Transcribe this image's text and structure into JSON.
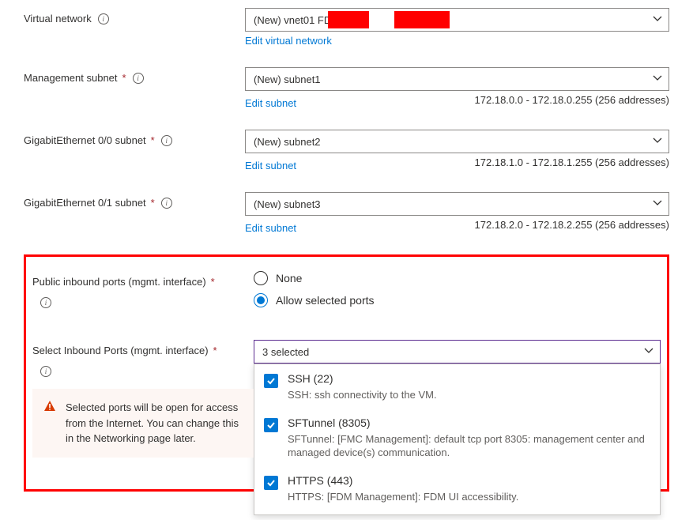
{
  "fields": {
    "vnet": {
      "label": "Virtual network",
      "value": "(New) vnet01            FDM",
      "editLink": "Edit virtual network"
    },
    "mgmtSubnet": {
      "label": "Management subnet",
      "value": "(New) subnet1",
      "editLink": "Edit subnet",
      "addr": "172.18.0.0 - 172.18.0.255 (256 addresses)"
    },
    "ge00": {
      "label": "GigabitEthernet 0/0 subnet",
      "value": "(New) subnet2",
      "editLink": "Edit subnet",
      "addr": "172.18.1.0 - 172.18.1.255 (256 addresses)"
    },
    "ge01": {
      "label": "GigabitEthernet 0/1 subnet",
      "value": "(New) subnet3",
      "editLink": "Edit subnet",
      "addr": "172.18.2.0 - 172.18.2.255 (256 addresses)"
    },
    "publicInbound": {
      "label": "Public inbound ports (mgmt. interface)",
      "optNone": "None",
      "optAllow": "Allow selected ports"
    },
    "selectInbound": {
      "label": "Select Inbound Ports (mgmt. interface)",
      "summary": "3 selected",
      "options": [
        {
          "title": "SSH (22)",
          "desc": "SSH: ssh connectivity to the VM."
        },
        {
          "title": "SFTunnel (8305)",
          "desc": "SFTunnel: [FMC Management]: default tcp port 8305: management center and managed device(s) communication."
        },
        {
          "title": "HTTPS (443)",
          "desc": "HTTPS: [FDM Management]: FDM UI accessibility."
        }
      ]
    }
  },
  "warning": "Selected ports will be open for access from the Internet. You can change this in the Networking page later."
}
